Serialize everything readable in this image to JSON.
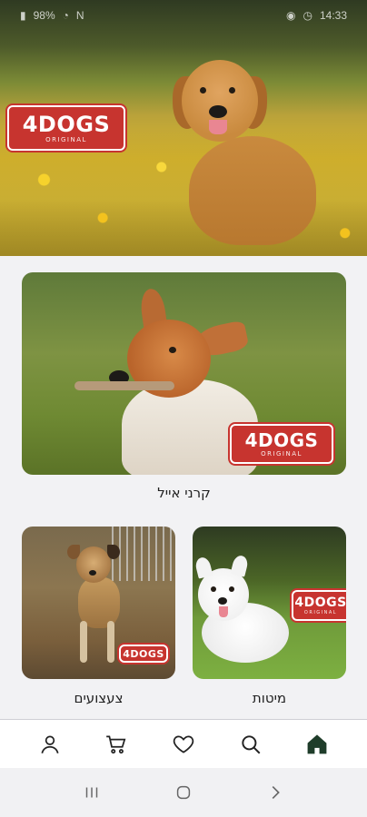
{
  "status_bar": {
    "battery": "98%",
    "time": "14:33"
  },
  "hero": {
    "brand": {
      "name": "4DOGS",
      "tagline": "ORIGINAL"
    }
  },
  "categories": [
    {
      "label": "קרני אייל",
      "brand_name": "4DOGS",
      "brand_tagline": "ORIGINAL"
    },
    {
      "label": "צעצועים",
      "brand_name": "4DOGS"
    },
    {
      "label": "מיטות",
      "brand_name": "4DOGS",
      "brand_tagline": "ORIGINAL"
    }
  ],
  "bottom_nav": [
    {
      "icon": "profile-icon"
    },
    {
      "icon": "cart-icon"
    },
    {
      "icon": "heart-icon"
    },
    {
      "icon": "search-icon"
    },
    {
      "icon": "home-icon",
      "active": true
    }
  ],
  "colors": {
    "brand_red": "#c7342f",
    "nav_active": "#1f3d2a",
    "nav_icon": "#222222"
  }
}
